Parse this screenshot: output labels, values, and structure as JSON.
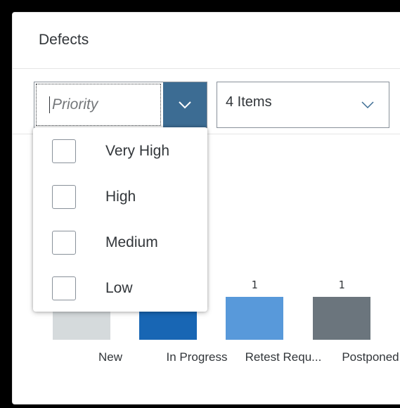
{
  "card": {
    "title": "Defects"
  },
  "filters": {
    "priority": {
      "placeholder": "Priority",
      "value": ""
    },
    "status": {
      "value": "4 Items"
    }
  },
  "dropdown": {
    "options": [
      {
        "label": "Very High",
        "checked": false
      },
      {
        "label": "High",
        "checked": false
      },
      {
        "label": "Medium",
        "checked": false
      },
      {
        "label": "Low",
        "checked": false
      }
    ]
  },
  "chart_data": {
    "type": "bar",
    "categories": [
      "New",
      "In Progress",
      "Retest Requ...",
      "Postponed"
    ],
    "values": [
      1,
      1,
      1,
      1
    ],
    "colors": [
      "#d5dadc",
      "#1866b4",
      "#5899da",
      "#6b757d"
    ],
    "title": "",
    "xlabel": "",
    "ylabel": ""
  },
  "colors": {
    "accent": "#3c6c93",
    "border": "#89919a",
    "text": "#32363a"
  }
}
